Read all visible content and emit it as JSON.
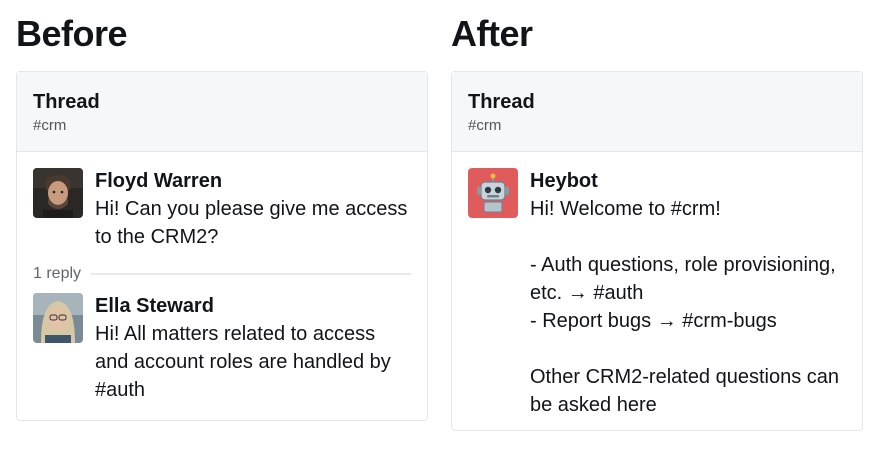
{
  "before": {
    "heading": "Before",
    "thread_title": "Thread",
    "channel": "#crm",
    "message": {
      "author": "Floyd Warren",
      "text": "Hi! Can you please give me access to the CRM2?"
    },
    "reply_count": "1 reply",
    "reply": {
      "author": "Ella Steward",
      "text": "Hi! All matters related to access and account roles are handled by #auth"
    }
  },
  "after": {
    "heading": "After",
    "thread_title": "Thread",
    "channel": "#crm",
    "message": {
      "author": "Heybot",
      "text": "Hi! Welcome to #crm!\n\n- Auth questions, role provisioning, etc. → #auth\n- Report bugs → #crm-bugs\n\nOther CRM2-related questions can be asked here"
    }
  }
}
